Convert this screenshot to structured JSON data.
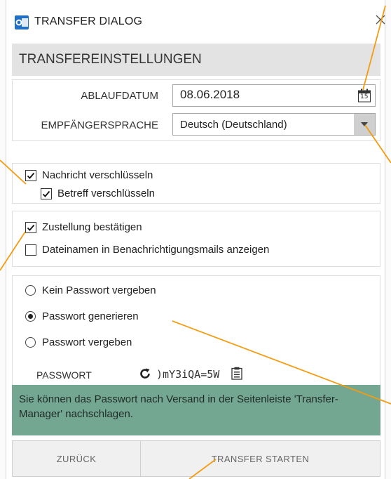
{
  "window": {
    "title": "TRANSFER DIALOG",
    "app_icon": "outlook-icon",
    "close_icon": "close-icon"
  },
  "section": {
    "title": "TRANSFEREINSTELLUNGEN"
  },
  "fields": {
    "expiry_label": "ABLAUFDATUM",
    "expiry_value": "08.06.2018",
    "calendar_day": "15",
    "language_label": "EMPFÄNGERSPRACHE",
    "language_value": "Deutsch (Deutschland)"
  },
  "encryption": {
    "encrypt_message": {
      "label": "Nachricht verschlüsseln",
      "checked": true
    },
    "encrypt_subject": {
      "label": "Betreff verschlüsseln",
      "checked": true
    }
  },
  "notifications": {
    "confirm_delivery": {
      "label": "Zustellung bestätigen",
      "checked": true
    },
    "show_filenames": {
      "label": "Dateinamen in Benachrichtigungsmails anzeigen",
      "checked": false
    }
  },
  "password": {
    "options": [
      {
        "label": "Kein Passwort vergeben",
        "selected": false
      },
      {
        "label": "Passwort generieren",
        "selected": true
      },
      {
        "label": "Passwort vergeben",
        "selected": false
      }
    ],
    "label": "PASSWORT",
    "value": ")mY3iQA=5W",
    "refresh_icon": "refresh-icon",
    "copy_icon": "clipboard-icon"
  },
  "info": {
    "text": "Sie können das Passwort nach Versand in der Seitenleiste 'Transfer-Manager' nachschlagen."
  },
  "footer": {
    "back_label": "ZURÜCK",
    "start_label": "TRANSFER STARTEN"
  },
  "colors": {
    "info_bar": "#74a791",
    "header_bg": "#e3e3e3",
    "callout_line": "#f39c12",
    "outlook_blue": "#1f6fc5"
  }
}
